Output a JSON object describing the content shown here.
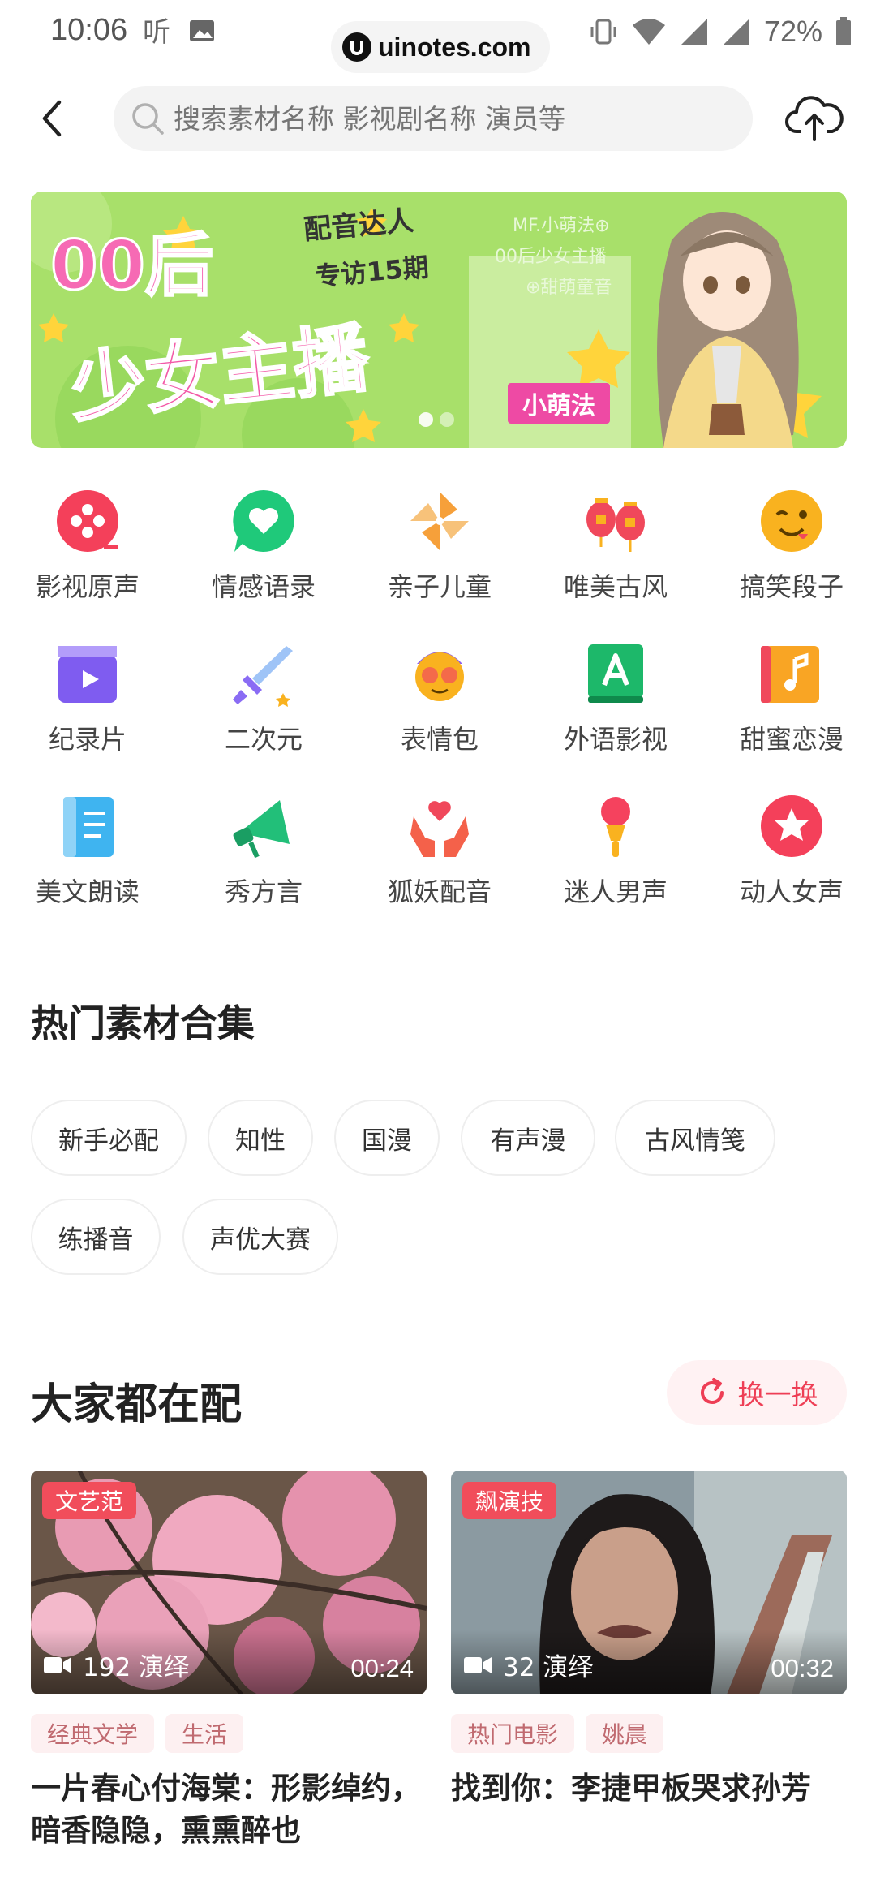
{
  "status_bar": {
    "time": "10:06",
    "url": "uinotes.com",
    "battery": "72%"
  },
  "header": {
    "search_placeholder": "搜索素材名称 影视剧名称 演员等"
  },
  "banner": {
    "headline_top": "00后",
    "headline_sub_1": "配音达人",
    "headline_sub_2": "专访15期",
    "headline_main": "少女主播",
    "right_line_1": "MF.小萌法⊕",
    "right_line_2": "00后少女主播",
    "right_line_3": "⊕甜萌童音",
    "name_tag": "小萌法"
  },
  "categories": [
    {
      "label": "影视原声",
      "icon": "film-reel-icon",
      "color": "#f4405a"
    },
    {
      "label": "情感语录",
      "icon": "heart-chat-icon",
      "color": "#1fc97a"
    },
    {
      "label": "亲子儿童",
      "icon": "pinwheel-icon",
      "color": "#f6a03a"
    },
    {
      "label": "唯美古风",
      "icon": "lantern-icon",
      "color": "#f0485b"
    },
    {
      "label": "搞笑段子",
      "icon": "wink-face-icon",
      "color": "#f9b21f"
    },
    {
      "label": "纪录片",
      "icon": "clapper-icon",
      "color": "#7f5cf0"
    },
    {
      "label": "二次元",
      "icon": "sword-icon",
      "color": "#8a6cf4"
    },
    {
      "label": "表情包",
      "icon": "cool-face-icon",
      "color": "#f46a4a"
    },
    {
      "label": "外语影视",
      "icon": "letter-a-book-icon",
      "color": "#1db86a"
    },
    {
      "label": "甜蜜恋漫",
      "icon": "music-book-icon",
      "color": "#f9a524"
    },
    {
      "label": "美文朗读",
      "icon": "notebook-icon",
      "color": "#3fb4f0"
    },
    {
      "label": "秀方言",
      "icon": "megaphone-icon",
      "color": "#22bf79"
    },
    {
      "label": "狐妖配音",
      "icon": "hands-heart-icon",
      "color": "#f4614a"
    },
    {
      "label": "迷人男声",
      "icon": "microphone-icon",
      "color": "#f5425e"
    },
    {
      "label": "动人女声",
      "icon": "star-circle-icon",
      "color": "#f4405a"
    }
  ],
  "hot": {
    "title": "热门素材合集",
    "chips": [
      "新手必配",
      "知性",
      "国漫",
      "有声漫",
      "古风情笺",
      "练播音",
      "声优大赛"
    ]
  },
  "popular": {
    "title": "大家都在配",
    "refresh_label": "换一换",
    "cards": [
      {
        "tag": "文艺范",
        "plays": "192 演绎",
        "duration": "00:24",
        "labels": [
          "经典文学",
          "生活"
        ],
        "title": "一片春心付海棠：形影绰约，暗香隐隐，熏熏醉也"
      },
      {
        "tag": "飙演技",
        "plays": "32 演绎",
        "duration": "00:32",
        "labels": [
          "热门电影",
          "姚晨"
        ],
        "title": "找到你：李捷甲板哭求孙芳"
      }
    ]
  }
}
